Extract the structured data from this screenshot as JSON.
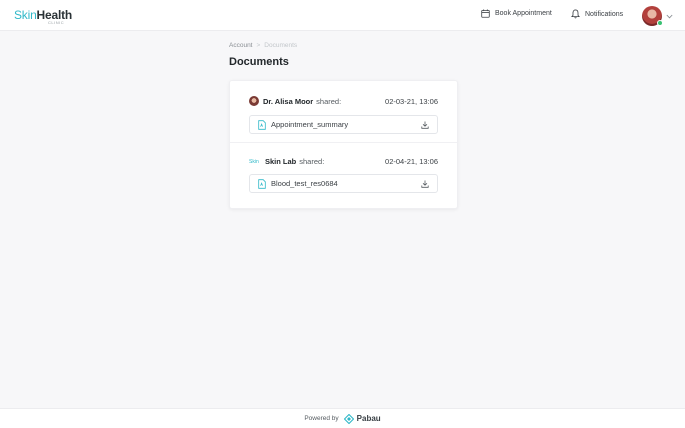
{
  "brand": {
    "logo_part1": "Skin",
    "logo_part2": "Health",
    "logo_sub": "CLINIC"
  },
  "header": {
    "book_label": "Book Appointment",
    "notifications_label": "Notifications"
  },
  "breadcrumb": {
    "parent": "Account",
    "separator": ">",
    "current": "Documents"
  },
  "page": {
    "title": "Documents"
  },
  "shares": [
    {
      "sharer": "Dr. Alisa Moor",
      "shared_word": "shared:",
      "date": "02-03-21, 13:06",
      "file": "Appointment_summary"
    },
    {
      "sharer_logo": "Skin",
      "sharer": "Skin Lab",
      "shared_word": "shared:",
      "date": "02-04-21, 13:06",
      "file": "Blood_test_res0684"
    }
  ],
  "footer": {
    "powered": "Powered by",
    "brand": "Pabau"
  },
  "colors": {
    "accent": "#2fb8c8",
    "text_dark": "#22272b",
    "background": "#f7f7f9"
  },
  "icons": [
    "calendar-icon",
    "bell-icon",
    "chevron-down-icon",
    "document-icon",
    "download-icon",
    "pabau-logo-icon"
  ]
}
